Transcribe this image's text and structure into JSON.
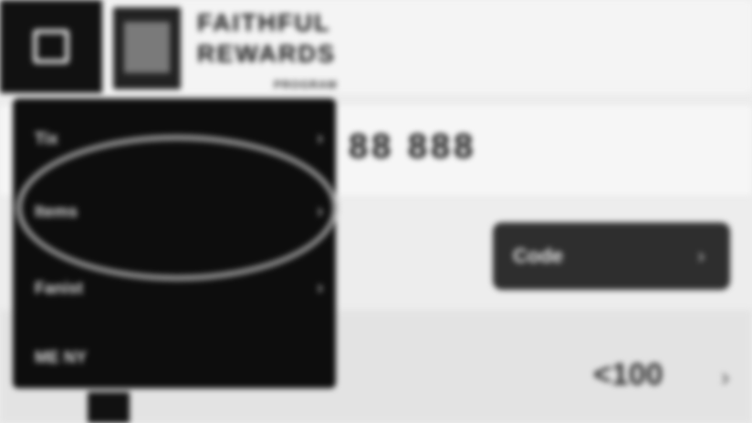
{
  "header": {
    "brand_line1": "FAITHFUL",
    "brand_line2": "REWARDS",
    "brand_sub": "PROGRAM"
  },
  "card": {
    "number_code": "88 888"
  },
  "select": {
    "label": "Code",
    "chevron": "›"
  },
  "pager": {
    "value": "<100",
    "next": "›"
  },
  "menu": {
    "items": [
      {
        "label": "Tix",
        "chevron": "›"
      },
      {
        "label": "Items",
        "chevron": "›"
      },
      {
        "label": "Fanist",
        "chevron": "›"
      },
      {
        "label": "ME NY",
        "chevron": ""
      }
    ]
  },
  "icons": {
    "menu_toggle": "square-menu-icon",
    "chevron": "chevron-right-icon"
  }
}
